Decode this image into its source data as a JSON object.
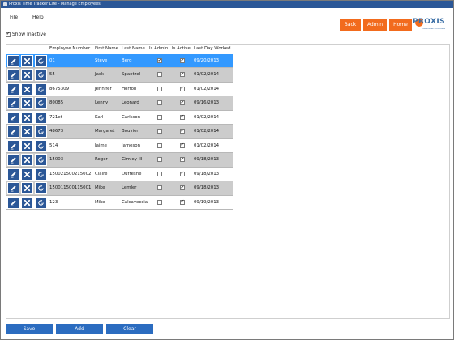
{
  "window": {
    "title": "Proxis Time Tracker Lite - Manage Employees"
  },
  "menu": {
    "file": "File",
    "help": "Help"
  },
  "nav": {
    "back": "Back",
    "admin": "Admin",
    "home": "Home"
  },
  "logo": {
    "name": "PROXIS",
    "tagline": "business solutions"
  },
  "filter": {
    "show_inactive_label": "Show Inactive",
    "show_inactive_checked": true
  },
  "table": {
    "columns": [
      "Employee Number",
      "First Name",
      "Last Name",
      "Is Admin",
      "Is Active",
      "Last Day Worked"
    ],
    "rows": [
      {
        "employee_number": "01",
        "first_name": "Steve",
        "last_name": "Berg",
        "is_admin": true,
        "is_active": true,
        "last_day_worked": "09/20/2013",
        "selected": true
      },
      {
        "employee_number": "55",
        "first_name": "Jack",
        "last_name": "Spaetzel",
        "is_admin": false,
        "is_active": true,
        "last_day_worked": "01/02/2014"
      },
      {
        "employee_number": "8675309",
        "first_name": "Jennifer",
        "last_name": "Horton",
        "is_admin": false,
        "is_active": true,
        "last_day_worked": "01/02/2014"
      },
      {
        "employee_number": "80085",
        "first_name": "Lenny",
        "last_name": "Leonard",
        "is_admin": false,
        "is_active": true,
        "last_day_worked": "09/16/2013"
      },
      {
        "employee_number": "721et",
        "first_name": "Karl",
        "last_name": "Carlsson",
        "is_admin": false,
        "is_active": true,
        "last_day_worked": "01/02/2014"
      },
      {
        "employee_number": "48673",
        "first_name": "Margaret",
        "last_name": "Bouvier",
        "is_admin": false,
        "is_active": true,
        "last_day_worked": "01/02/2014"
      },
      {
        "employee_number": "514",
        "first_name": "Jaime",
        "last_name": "Jameson",
        "is_admin": false,
        "is_active": true,
        "last_day_worked": "01/02/2014"
      },
      {
        "employee_number": "15003",
        "first_name": "Roger",
        "last_name": "Gimley III",
        "is_admin": false,
        "is_active": true,
        "last_day_worked": "09/18/2013"
      },
      {
        "employee_number": "150021500215002",
        "first_name": "Claire",
        "last_name": "Dufresne",
        "is_admin": false,
        "is_active": true,
        "last_day_worked": "09/18/2013"
      },
      {
        "employee_number": "150011500115001",
        "first_name": "Mike",
        "last_name": "Lemler",
        "is_admin": false,
        "is_active": true,
        "last_day_worked": "09/18/2013"
      },
      {
        "employee_number": "123",
        "first_name": "Mike",
        "last_name": "Calcaveccia",
        "is_admin": false,
        "is_active": true,
        "last_day_worked": "09/19/2013"
      }
    ],
    "row_actions": [
      "edit-icon",
      "delete-icon",
      "reset-icon"
    ]
  },
  "footer": {
    "save": "Save",
    "add": "Add",
    "clear": "Clear"
  },
  "colors": {
    "accent_orange": "#f26b1d",
    "action_blue": "#2b5797",
    "button_blue": "#2b6cc0",
    "selected_row": "#3399ff",
    "alt_row": "#cccccc"
  }
}
